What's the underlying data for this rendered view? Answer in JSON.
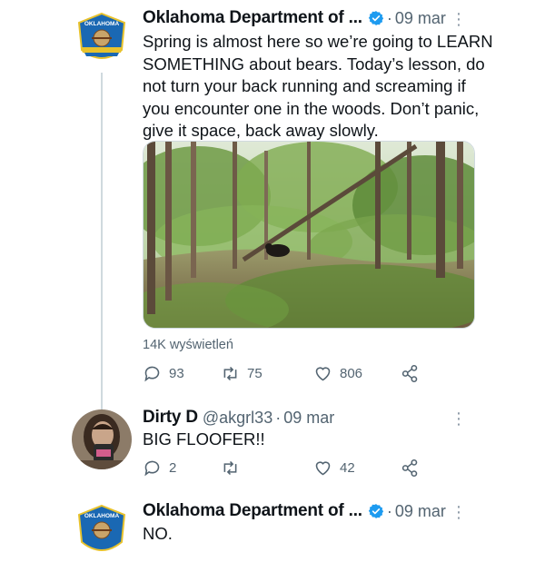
{
  "tweets": [
    {
      "author_name": "Oklahoma Department of ...",
      "date": "09 mar",
      "text_lines": [
        "Spring is almost here so we’re going to LEARN",
        "SOMETHING about bears. Today’s lesson, do",
        "not turn your back running and screaming if",
        "you encounter one in the woods. Don’t panic,",
        "give it space, back away slowly."
      ],
      "avatar_text": "OKLAHOMA",
      "views": "14K wyświetleń",
      "replies": "93",
      "retweets": "75",
      "likes": "806"
    },
    {
      "author_name": "Dirty D",
      "handle": "@akgrl33",
      "date": "09 mar",
      "text": "BIG FLOOFER!!",
      "replies": "2",
      "retweets": "",
      "likes": "42"
    },
    {
      "author_name": "Oklahoma Department of ...",
      "date": "09 mar",
      "text": "NO.",
      "avatar_text": "OKLAHOMA"
    }
  ],
  "icons": {
    "verified": "verified-badge-icon",
    "more": "more-options-icon",
    "reply": "reply-icon",
    "retweet": "retweet-icon",
    "like": "heart-icon",
    "share": "share-icon"
  },
  "colors": {
    "verified_blue": "#1d9bf0",
    "muted": "#536471"
  }
}
